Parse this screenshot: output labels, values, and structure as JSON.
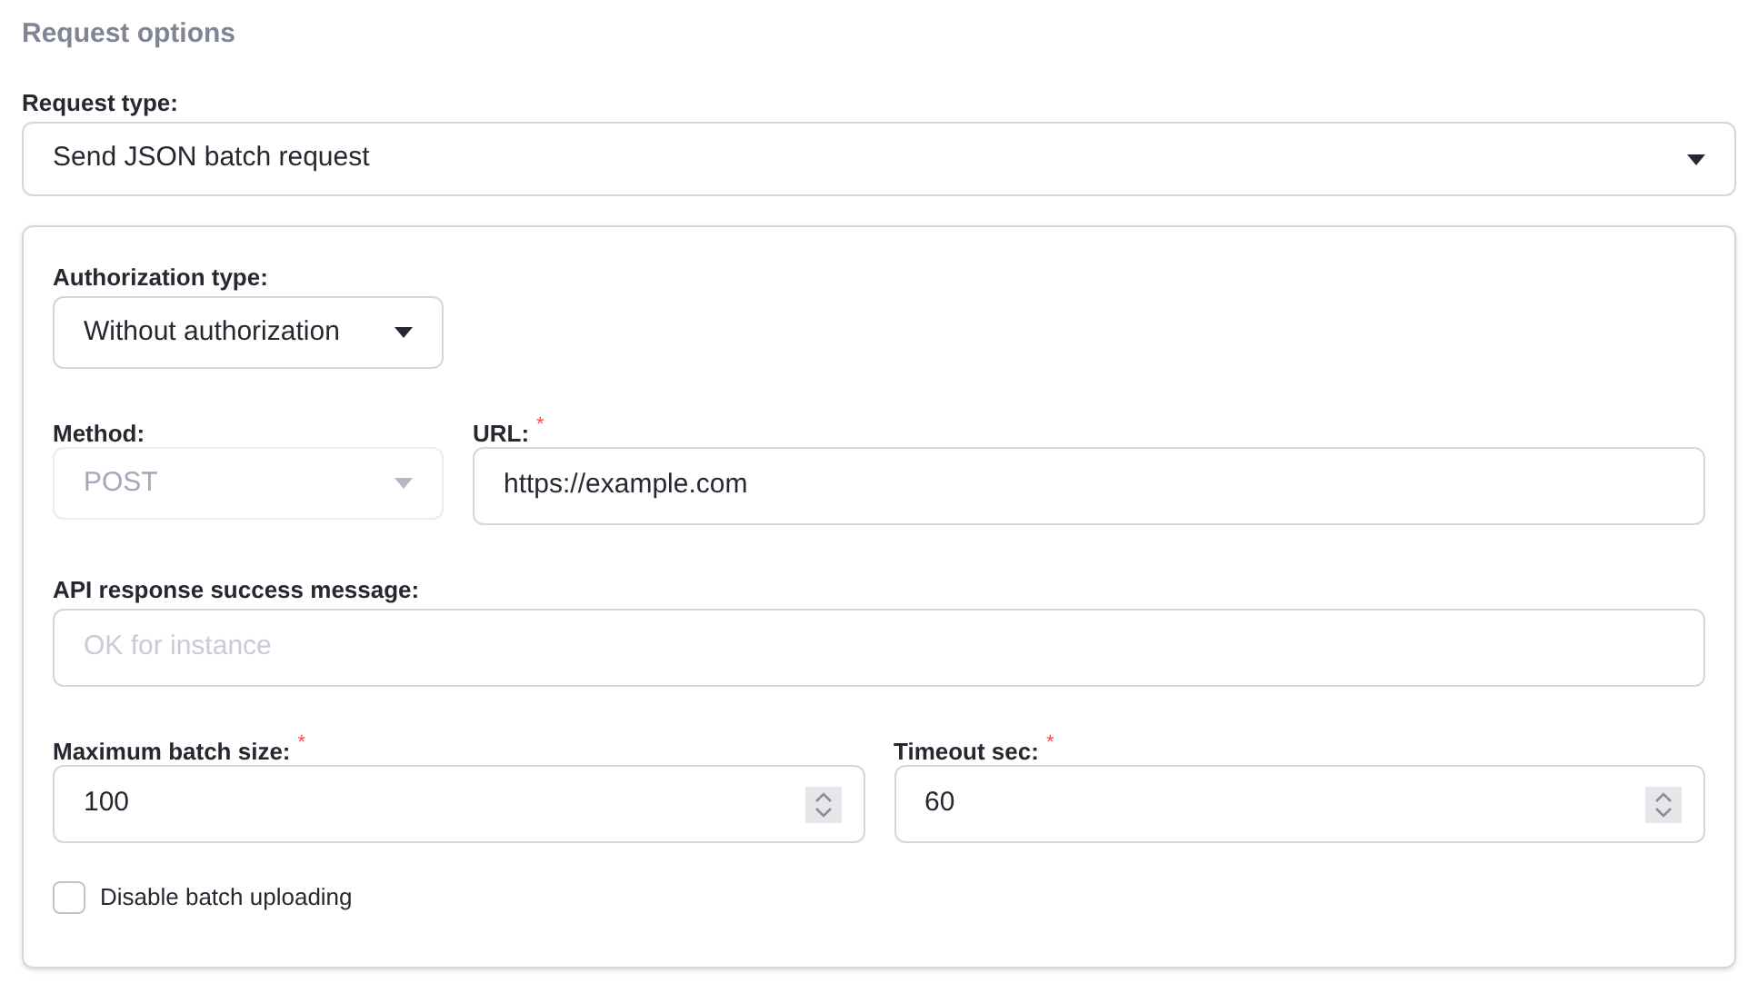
{
  "section_title": "Request options",
  "request_type": {
    "label": "Request type:",
    "value": "Send JSON batch request"
  },
  "authorization_type": {
    "label": "Authorization type:",
    "value": "Without authorization"
  },
  "method": {
    "label": "Method:",
    "value": "POST",
    "disabled": true
  },
  "url": {
    "label": "URL:",
    "required_mark": "*",
    "value": "https://example.com"
  },
  "success_message": {
    "label": "API response success message:",
    "placeholder": "OK for instance"
  },
  "max_batch_size": {
    "label": "Maximum batch size:",
    "required_mark": "*",
    "value": "100"
  },
  "timeout": {
    "label": "Timeout sec:",
    "required_mark": "*",
    "value": "60"
  },
  "disable_batch_uploading": {
    "label": "Disable batch uploading",
    "checked": false
  }
}
